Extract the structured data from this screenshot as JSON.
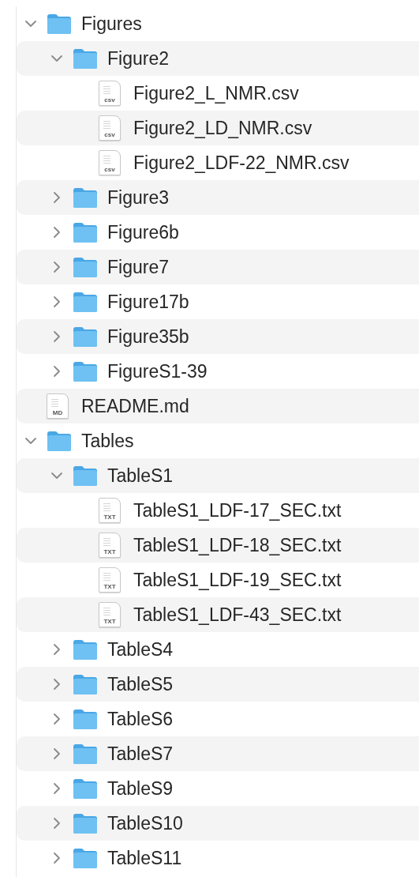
{
  "tree": [
    {
      "kind": "folder",
      "name": "Figures",
      "expanded": true,
      "children": [
        {
          "kind": "folder",
          "name": "Figure2",
          "expanded": true,
          "children": [
            {
              "kind": "file",
              "name": "Figure2_L_NMR.csv",
              "badge": "csv"
            },
            {
              "kind": "file",
              "name": "Figure2_LD_NMR.csv",
              "badge": "csv"
            },
            {
              "kind": "file",
              "name": "Figure2_LDF-22_NMR.csv",
              "badge": "csv"
            }
          ]
        },
        {
          "kind": "folder",
          "name": "Figure3",
          "expanded": false
        },
        {
          "kind": "folder",
          "name": "Figure6b",
          "expanded": false
        },
        {
          "kind": "folder",
          "name": "Figure7",
          "expanded": false
        },
        {
          "kind": "folder",
          "name": "Figure17b",
          "expanded": false
        },
        {
          "kind": "folder",
          "name": "Figure35b",
          "expanded": false
        },
        {
          "kind": "folder",
          "name": "FigureS1-39",
          "expanded": false
        }
      ]
    },
    {
      "kind": "file",
      "name": "README.md",
      "badge": "MD"
    },
    {
      "kind": "folder",
      "name": "Tables",
      "expanded": true,
      "children": [
        {
          "kind": "folder",
          "name": "TableS1",
          "expanded": true,
          "children": [
            {
              "kind": "file",
              "name": "TableS1_LDF-17_SEC.txt",
              "badge": "TXT"
            },
            {
              "kind": "file",
              "name": "TableS1_LDF-18_SEC.txt",
              "badge": "TXT"
            },
            {
              "kind": "file",
              "name": "TableS1_LDF-19_SEC.txt",
              "badge": "TXT"
            },
            {
              "kind": "file",
              "name": "TableS1_LDF-43_SEC.txt",
              "badge": "TXT"
            }
          ]
        },
        {
          "kind": "folder",
          "name": "TableS4",
          "expanded": false
        },
        {
          "kind": "folder",
          "name": "TableS5",
          "expanded": false
        },
        {
          "kind": "folder",
          "name": "TableS6",
          "expanded": false
        },
        {
          "kind": "folder",
          "name": "TableS7",
          "expanded": false
        },
        {
          "kind": "folder",
          "name": "TableS9",
          "expanded": false
        },
        {
          "kind": "folder",
          "name": "TableS10",
          "expanded": false
        },
        {
          "kind": "folder",
          "name": "TableS11",
          "expanded": false
        }
      ]
    }
  ]
}
